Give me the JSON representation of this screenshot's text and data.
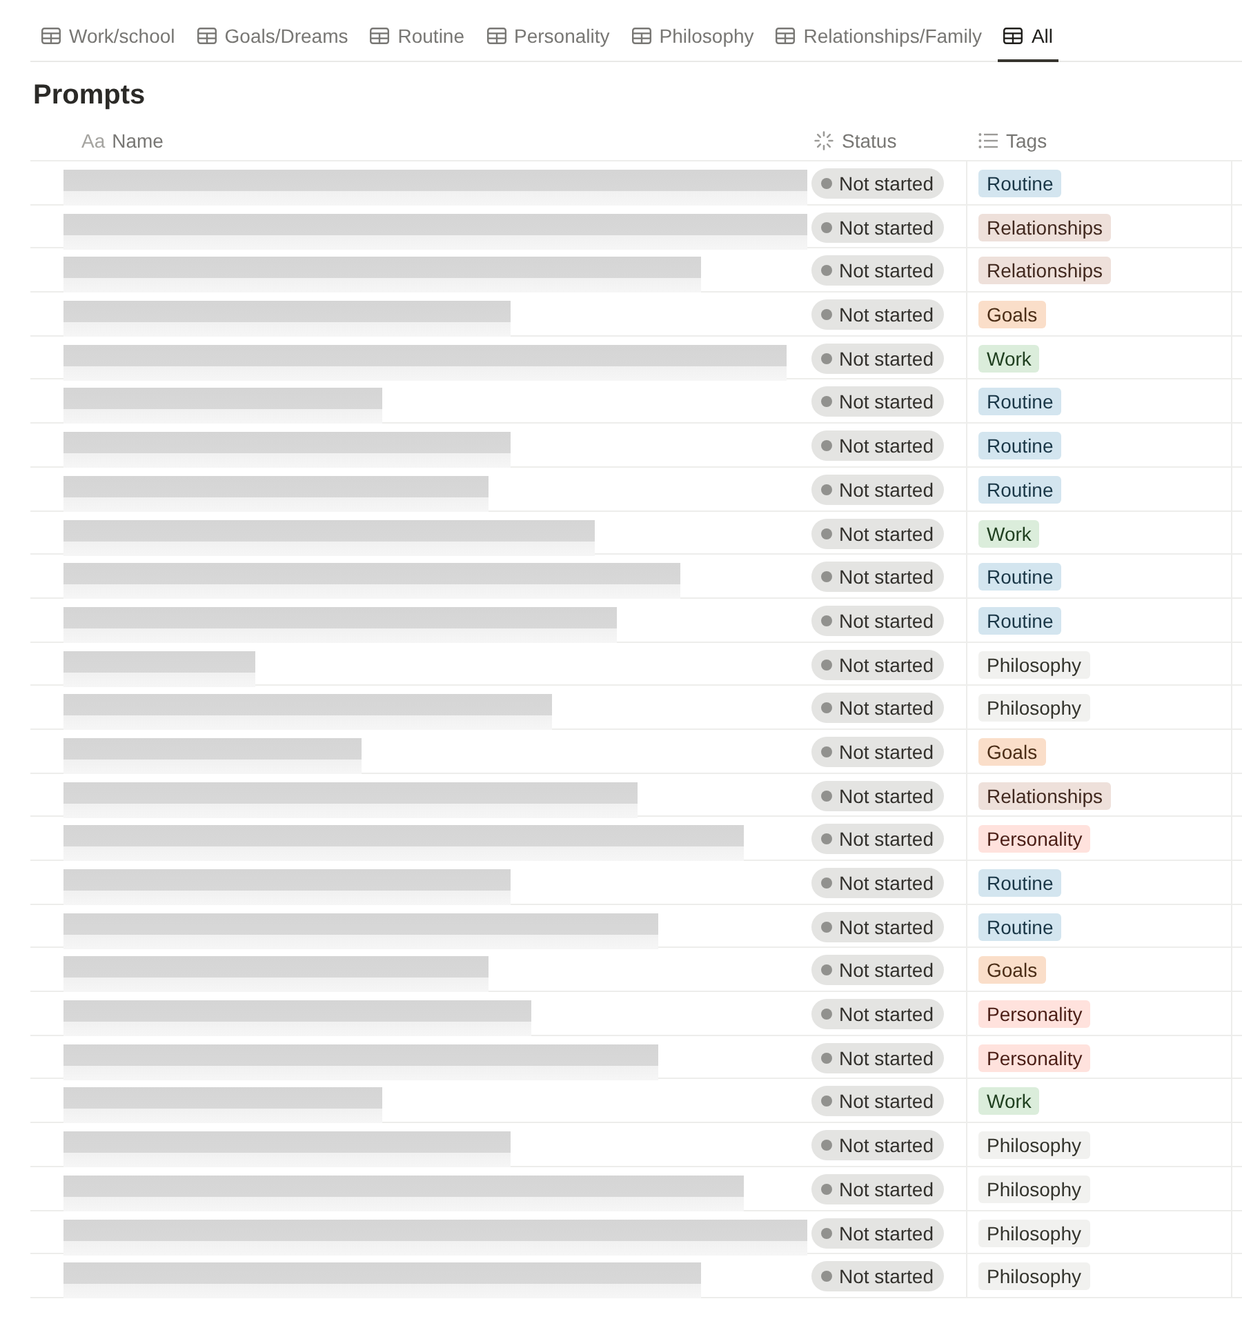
{
  "tabs": [
    {
      "label": "Work/school",
      "selected": false
    },
    {
      "label": "Goals/Dreams",
      "selected": false
    },
    {
      "label": "Routine",
      "selected": false
    },
    {
      "label": "Personality",
      "selected": false
    },
    {
      "label": "Philosophy",
      "selected": false
    },
    {
      "label": "Relationships/Family",
      "selected": false
    },
    {
      "label": "All",
      "selected": true
    }
  ],
  "title": "Prompts",
  "columns": [
    {
      "kind": "title",
      "icon_text": "Aa",
      "label": "Name"
    },
    {
      "kind": "status",
      "label": "Status"
    },
    {
      "kind": "multi_select",
      "label": "Tags"
    }
  ],
  "rows": [
    {
      "status": "Not started",
      "tag": {
        "label": "Routine",
        "color": "#d3e5ef"
      }
    },
    {
      "status": "Not started",
      "tag": {
        "label": "Relationships",
        "color": "#eee0da"
      }
    },
    {
      "status": "Not started",
      "tag": {
        "label": "Relationships",
        "color": "#eee0da"
      }
    },
    {
      "status": "Not started",
      "tag": {
        "label": "Goals",
        "color": "#fadec9"
      }
    },
    {
      "status": "Not started",
      "tag": {
        "label": "Work",
        "color": "#dbeddb"
      }
    },
    {
      "status": "Not started",
      "tag": {
        "label": "Routine",
        "color": "#d3e5ef"
      }
    },
    {
      "status": "Not started",
      "tag": {
        "label": "Routine",
        "color": "#d3e5ef"
      }
    },
    {
      "status": "Not started",
      "tag": {
        "label": "Routine",
        "color": "#d3e5ef"
      }
    },
    {
      "status": "Not started",
      "tag": {
        "label": "Work",
        "color": "#dbeddb"
      }
    },
    {
      "status": "Not started",
      "tag": {
        "label": "Routine",
        "color": "#d3e5ef"
      }
    },
    {
      "status": "Not started",
      "tag": {
        "label": "Routine",
        "color": "#d3e5ef"
      }
    },
    {
      "status": "Not started",
      "tag": {
        "label": "Philosophy",
        "color": "#f1f1ef"
      }
    },
    {
      "status": "Not started",
      "tag": {
        "label": "Philosophy",
        "color": "#f1f1ef"
      }
    },
    {
      "status": "Not started",
      "tag": {
        "label": "Goals",
        "color": "#fadec9"
      }
    },
    {
      "status": "Not started",
      "tag": {
        "label": "Relationships",
        "color": "#eee0da"
      }
    },
    {
      "status": "Not started",
      "tag": {
        "label": "Personality",
        "color": "#ffe2dd"
      }
    },
    {
      "status": "Not started",
      "tag": {
        "label": "Routine",
        "color": "#d3e5ef"
      }
    },
    {
      "status": "Not started",
      "tag": {
        "label": "Routine",
        "color": "#d3e5ef"
      }
    },
    {
      "status": "Not started",
      "tag": {
        "label": "Goals",
        "color": "#fadec9"
      }
    },
    {
      "status": "Not started",
      "tag": {
        "label": "Personality",
        "color": "#ffe2dd"
      }
    },
    {
      "status": "Not started",
      "tag": {
        "label": "Personality",
        "color": "#ffe2dd"
      }
    },
    {
      "status": "Not started",
      "tag": {
        "label": "Work",
        "color": "#dbeddb"
      }
    },
    {
      "status": "Not started",
      "tag": {
        "label": "Philosophy",
        "color": "#f1f1ef"
      }
    },
    {
      "status": "Not started",
      "tag": {
        "label": "Philosophy",
        "color": "#f1f1ef"
      }
    },
    {
      "status": "Not started",
      "tag": {
        "label": "Philosophy",
        "color": "#f1f1ef"
      }
    },
    {
      "status": "Not started",
      "tag": {
        "label": "Philosophy",
        "color": "#f1f1ef"
      }
    }
  ]
}
